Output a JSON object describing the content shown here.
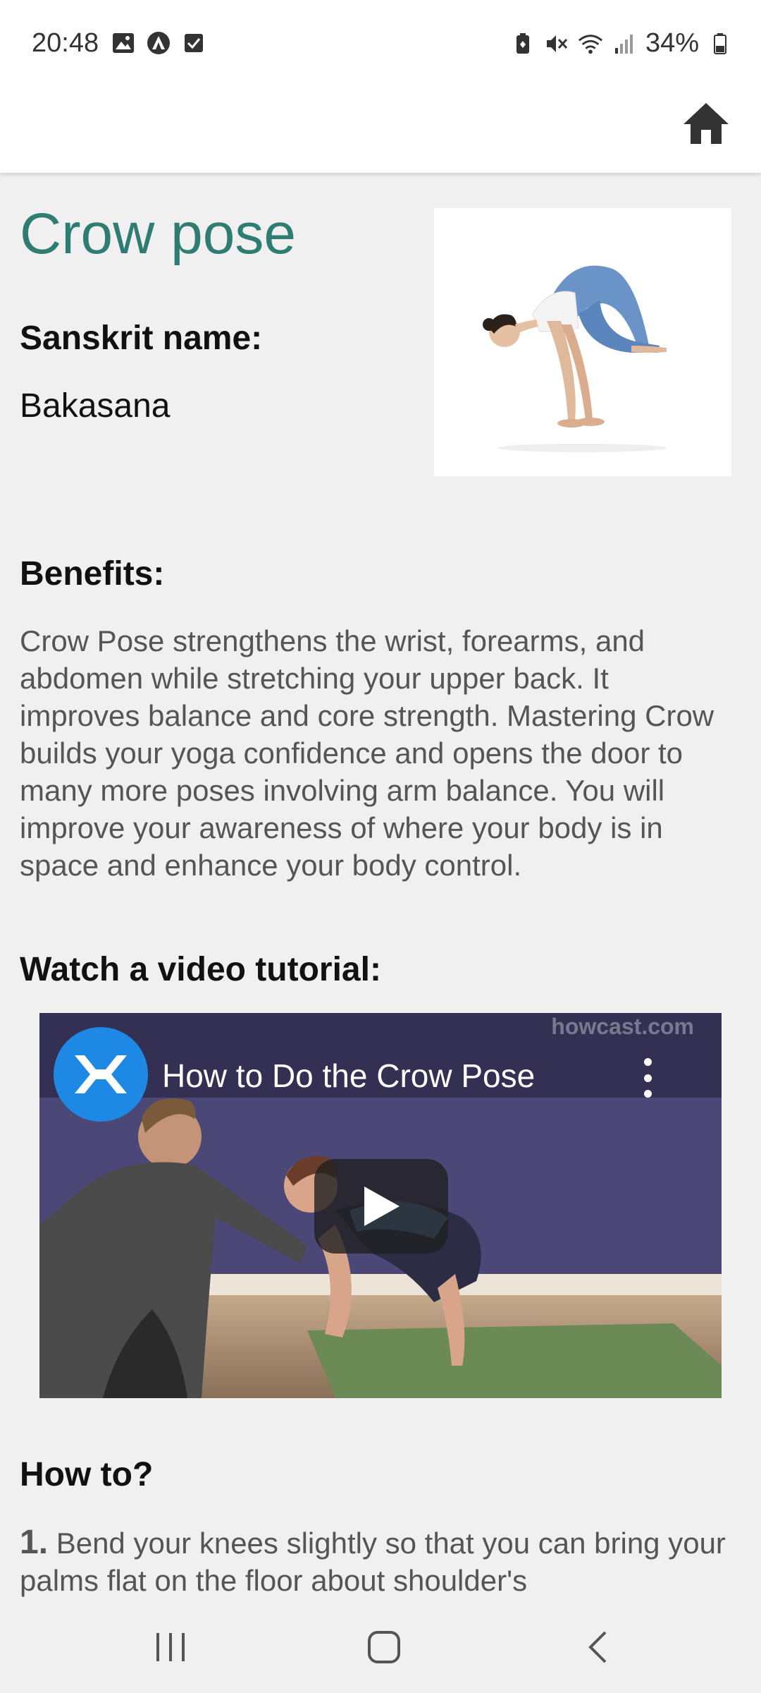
{
  "status_bar": {
    "time": "20:48",
    "battery_percent": "34%",
    "left_icons": [
      "gallery-icon",
      "android-auto-icon",
      "checkbox-icon"
    ],
    "right_icons": [
      "battery-saver-icon",
      "mute-icon",
      "wifi-icon",
      "signal-icon",
      "battery-icon"
    ]
  },
  "app_bar": {
    "home_icon": "home-icon"
  },
  "pose": {
    "title": "Crow pose",
    "sanskrit_label": "Sanskrit name:",
    "sanskrit_value": "Bakasana",
    "benefits_label": "Benefits:",
    "benefits_text": "Crow Pose strengthens the wrist, forearms, and abdomen while stretching your upper back. It improves balance and core strength. Mastering Crow builds your yoga confidence and opens the door to many more poses involving arm balance. You will improve your awareness of where your body is in space and enhance your body control.",
    "video_label": "Watch a video tutorial:",
    "howto_label": "How to?"
  },
  "video": {
    "title": "How to Do the Crow Pose",
    "watermark": "howcast.com"
  },
  "steps": [
    {
      "number": "1.",
      "text": "Bend your knees slightly so that you can bring your palms flat on the floor about shoulder's"
    }
  ],
  "colors": {
    "title": "#2f7d72",
    "background": "#f0f0f0",
    "video_logo": "#1e88e5"
  }
}
